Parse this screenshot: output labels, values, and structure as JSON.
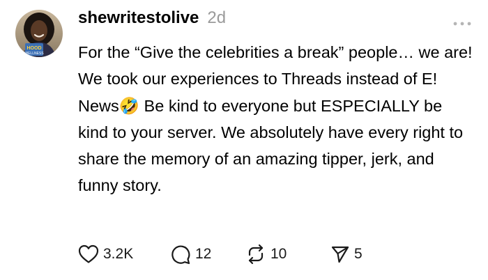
{
  "post": {
    "username": "shewritestolive",
    "timestamp": "2d",
    "avatar_badge_text": "HOOD WELLNESS",
    "body": "For the “Give the celebrities a break” people… we are! We took our experiences to Threads instead of E! News🤣 Be kind to everyone but ESPECIALLY be kind to your server. We absolutely have every right to share the memory of an amazing tipper, jerk, and funny story.",
    "actions": {
      "likes": "3.2K",
      "replies": "12",
      "reposts": "10",
      "shares": "5"
    }
  },
  "icons": {
    "avatar": "profile-photo",
    "more": "ellipsis-icon",
    "like": "heart-icon",
    "reply": "speech-bubble-icon",
    "repost": "repost-arrows-icon",
    "share": "paper-plane-icon"
  },
  "colors": {
    "text": "#000000",
    "muted": "#9a9a9a",
    "icon": "#1a1a1a"
  }
}
